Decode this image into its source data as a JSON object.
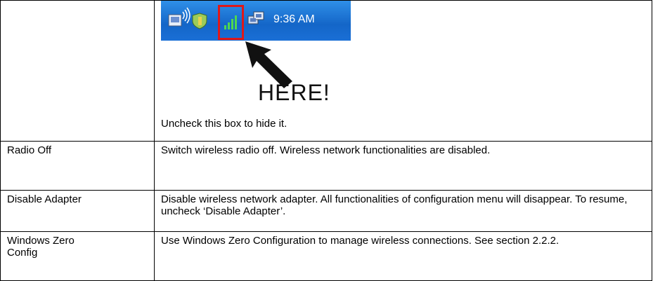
{
  "screenshot": {
    "clock": "9:36 AM",
    "here_label": "HERE!",
    "icons": [
      "wireless-status-icon",
      "shield-icon",
      "signal-bars-icon",
      "network-icon"
    ],
    "highlight_color": "#e01818"
  },
  "rows": [
    {
      "name": "",
      "caption": "Uncheck this box to hide it."
    },
    {
      "name": "Radio Off",
      "desc": "Switch wireless radio off. Wireless network functionalities are disabled."
    },
    {
      "name": "Disable Adapter",
      "desc": "Disable wireless network adapter. All functionalities of configuration menu will disappear. To resume, uncheck ‘Disable Adapter’."
    },
    {
      "name": "Windows Zero Config",
      "desc": "Use Windows Zero Configuration to manage wireless connections. See section 2.2.2."
    }
  ]
}
